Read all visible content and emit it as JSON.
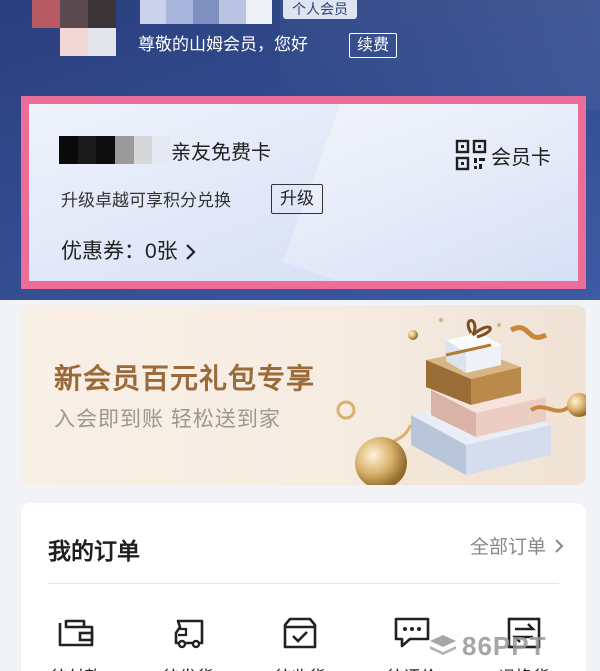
{
  "header": {
    "member_tag": "个人会员",
    "greeting": "尊敬的山姆会员，您好",
    "renew_label": "续费"
  },
  "card": {
    "title": "亲友免费卡",
    "qr_label": "会员卡",
    "upgrade_text": "升级卓越可享积分兑换",
    "upgrade_button": "升级",
    "coupons": "优惠券：0张"
  },
  "promo": {
    "title": "新会员百元礼包专享",
    "subtitle": "入会即到账 轻松送到家"
  },
  "orders": {
    "title": "我的订单",
    "all_label": "全部订单",
    "items": [
      {
        "label": "待付款",
        "icon": "wallet-icon"
      },
      {
        "label": "待发货",
        "icon": "truck-icon"
      },
      {
        "label": "待收货",
        "icon": "box-icon"
      },
      {
        "label": "待评价",
        "icon": "comment-icon"
      },
      {
        "label": "退换货",
        "icon": "return-icon"
      }
    ]
  },
  "watermark": "86PPT",
  "colors": {
    "header_bg": "#324b8e",
    "highlight_border": "#ec6d97",
    "promo_title": "#9a6a3a"
  }
}
